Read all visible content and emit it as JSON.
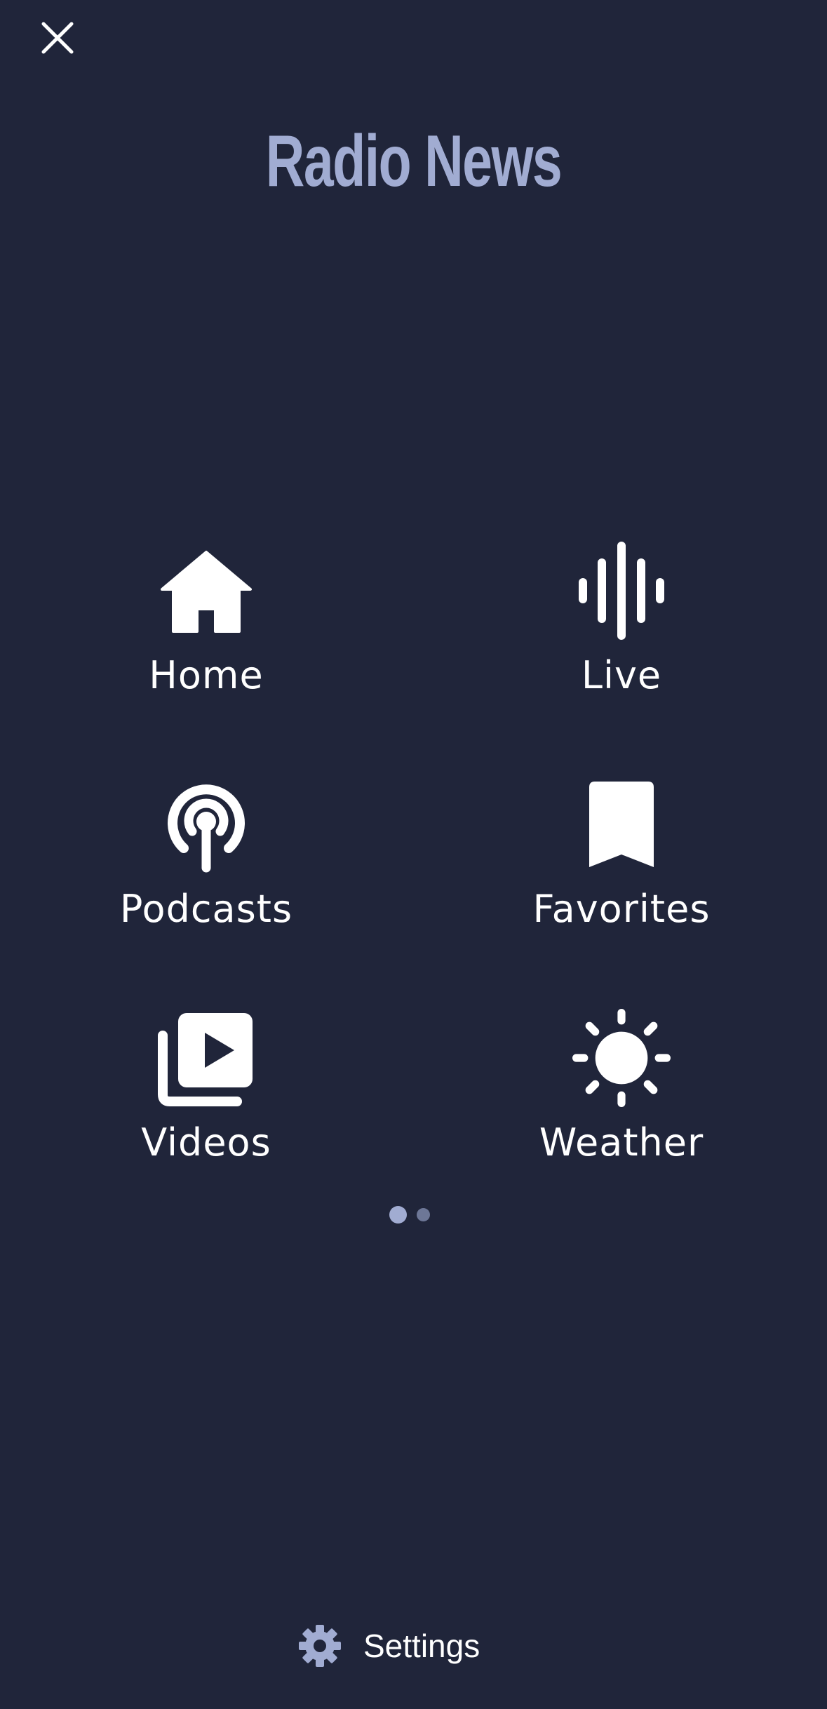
{
  "app": {
    "title": "Radio News"
  },
  "menu": {
    "items": [
      {
        "label": "Home",
        "icon": "home-icon"
      },
      {
        "label": "Live",
        "icon": "live-audio-icon"
      },
      {
        "label": "Podcasts",
        "icon": "podcast-icon"
      },
      {
        "label": "Favorites",
        "icon": "bookmark-icon"
      },
      {
        "label": "Videos",
        "icon": "video-library-icon"
      },
      {
        "label": "Weather",
        "icon": "sun-icon"
      }
    ]
  },
  "pagination": {
    "current_page": 1,
    "total_pages": 2
  },
  "footer": {
    "settings_label": "Settings",
    "settings_icon": "gear-icon"
  },
  "colors": {
    "background": "#20253a",
    "accent": "#a1acd2",
    "text": "#ffffff",
    "inactive_dot": "#6d7797"
  }
}
